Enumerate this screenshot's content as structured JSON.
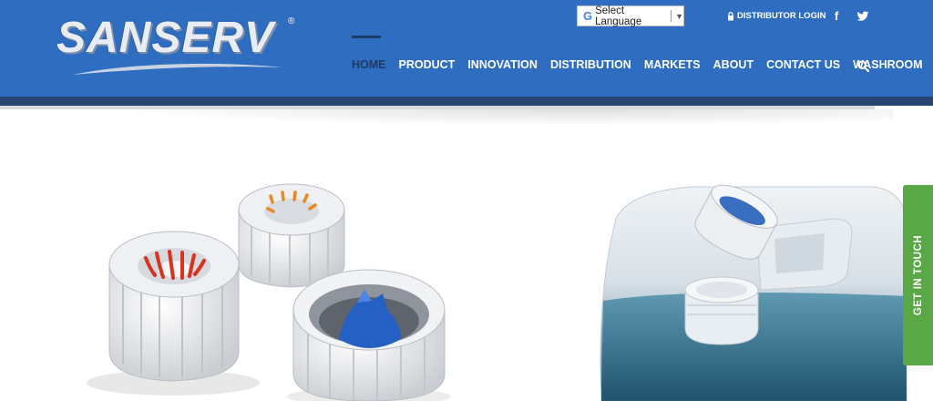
{
  "brand": {
    "name": "SANSERV",
    "registered": "®"
  },
  "language_selector": {
    "label": "Select Language",
    "caret": "▼"
  },
  "top_links": {
    "distributor_login": "DISTRIBUTOR LOGIN"
  },
  "social": {
    "facebook": "f"
  },
  "nav": {
    "items": [
      {
        "label": "HOME",
        "active": true
      },
      {
        "label": "PRODUCT"
      },
      {
        "label": "INNOVATION"
      },
      {
        "label": "DISTRIBUTION"
      },
      {
        "label": "MARKETS"
      },
      {
        "label": "ABOUT"
      },
      {
        "label": "CONTACT US"
      },
      {
        "label": "WASHROOM"
      }
    ]
  },
  "cta": {
    "get_in_touch": "GET IN TOUCH"
  },
  "colors": {
    "header_blue": "#2f6dc1",
    "header_dark_band": "#23456f",
    "active_nav": "#1d3b66",
    "cta_green": "#5aa845"
  },
  "icons": [
    "google-icon",
    "lock-icon",
    "facebook-icon",
    "twitter-icon",
    "search-icon"
  ]
}
